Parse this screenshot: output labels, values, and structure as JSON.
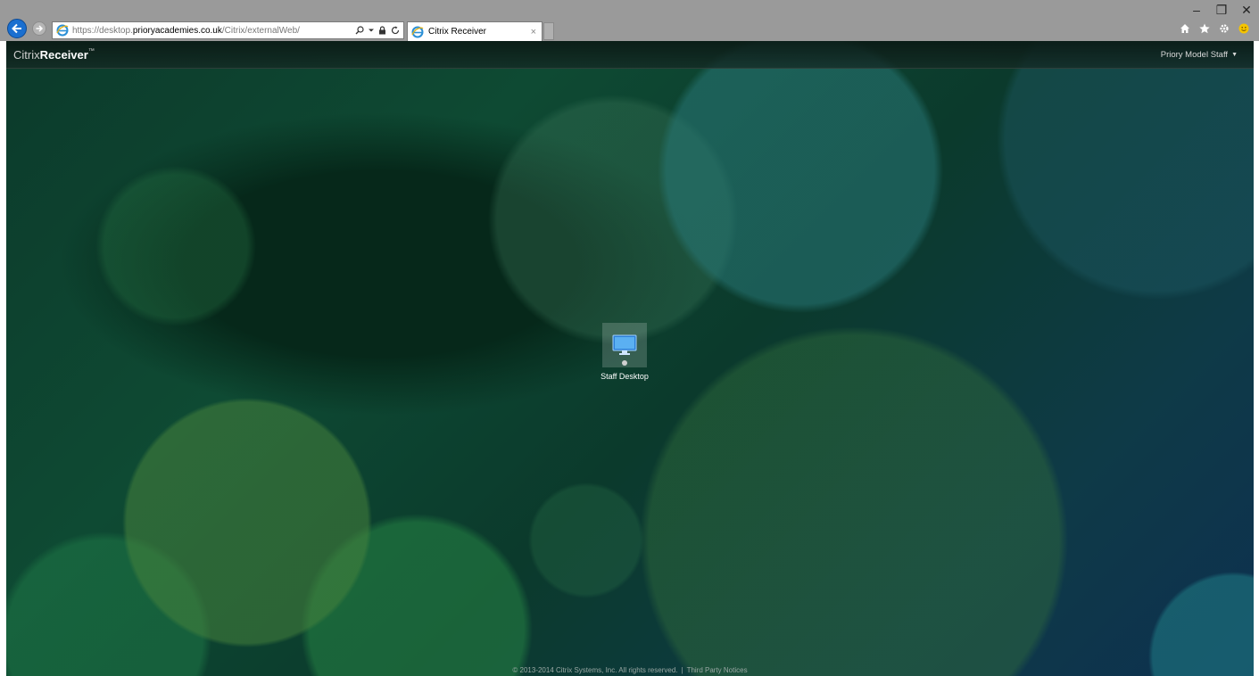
{
  "browser": {
    "url_prefix": "https://desktop.",
    "url_domain": "prioryacademies.co.uk",
    "url_path": "/Citrix/externalWeb/",
    "tab_title": "Citrix Receiver",
    "tab_close": "×",
    "window_controls": {
      "minimize": "–",
      "restore": "❐",
      "close": "✕"
    },
    "icons": [
      "back-arrow-icon",
      "forward-arrow-icon",
      "ie-logo-icon",
      "search-icon",
      "dropdown-icon",
      "lock-icon",
      "refresh-icon",
      "home-icon",
      "favorites-star-icon",
      "settings-gear-icon",
      "feedback-smiley-icon"
    ]
  },
  "receiver": {
    "brand_light": "Citrix",
    "brand_bold": "Receiver",
    "brand_tm": "™",
    "user_name": "Priory Model Staff",
    "apps": [
      {
        "label": "Staff Desktop",
        "icon": "monitor-icon"
      }
    ],
    "footer": {
      "copyright": "© 2013-2014 Citrix Systems, Inc. All rights reserved.",
      "separator": "|",
      "third_party": "Third Party Notices"
    }
  },
  "colors": {
    "accent_blue": "#1a6fd0",
    "chrome_gray": "#9a9a9a",
    "background_green": "#0e4a33",
    "smiley_yellow": "#f5c400"
  }
}
